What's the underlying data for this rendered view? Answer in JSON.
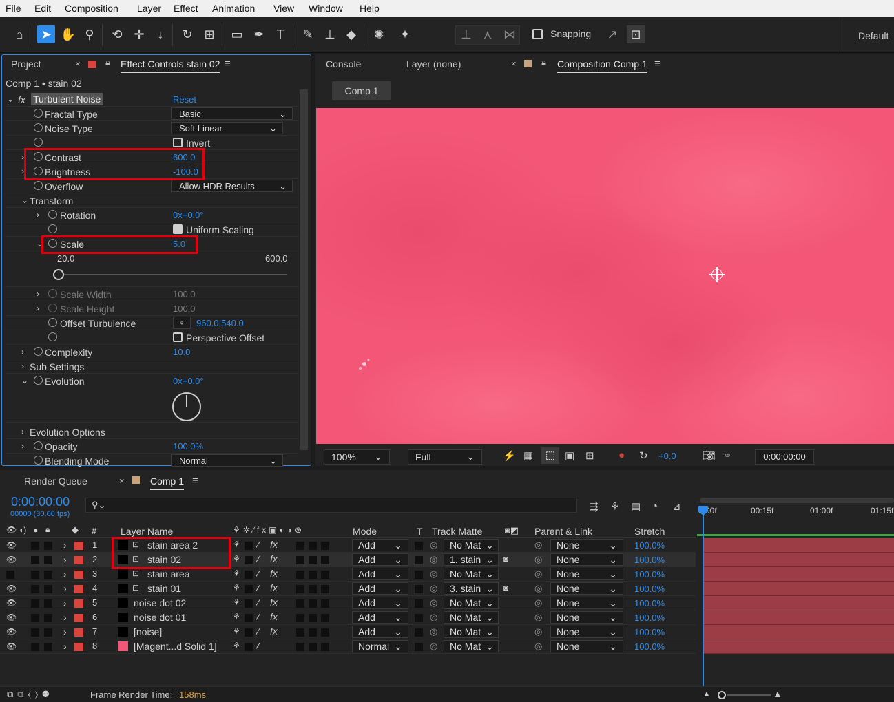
{
  "menu": [
    "File",
    "Edit",
    "Composition",
    "Layer",
    "Effect",
    "Animation",
    "View",
    "Window",
    "Help"
  ],
  "toolbar": {
    "snapping": "Snapping",
    "workspace": "Default"
  },
  "left_panel": {
    "tabs": {
      "project": "Project",
      "effect_controls": "Effect Controls stain 02"
    },
    "breadcrumb": "Comp 1 • stain 02",
    "effect_name": "Turbulent Noise",
    "reset": "Reset",
    "rows": {
      "fractal_type": {
        "label": "Fractal Type",
        "value": "Basic"
      },
      "noise_type": {
        "label": "Noise Type",
        "value": "Soft Linear"
      },
      "invert": {
        "label": "Invert"
      },
      "contrast": {
        "label": "Contrast",
        "value": "600.0"
      },
      "brightness": {
        "label": "Brightness",
        "value": "-100.0"
      },
      "overflow": {
        "label": "Overflow",
        "value": "Allow HDR Results"
      },
      "transform": {
        "label": "Transform"
      },
      "rotation": {
        "label": "Rotation",
        "value": "0x+0.0°"
      },
      "uniform_scaling": {
        "label": "Uniform Scaling"
      },
      "scale": {
        "label": "Scale",
        "value": "5.0",
        "min": "20.0",
        "max": "600.0"
      },
      "scale_width": {
        "label": "Scale Width",
        "value": "100.0"
      },
      "scale_height": {
        "label": "Scale Height",
        "value": "100.0"
      },
      "offset_turbulence": {
        "label": "Offset Turbulence",
        "value": "960.0,540.0"
      },
      "perspective_offset": {
        "label": "Perspective Offset"
      },
      "complexity": {
        "label": "Complexity",
        "value": "10.0"
      },
      "sub_settings": {
        "label": "Sub Settings"
      },
      "evolution": {
        "label": "Evolution",
        "value": "0x+0.0°"
      },
      "evolution_options": {
        "label": "Evolution Options"
      },
      "opacity": {
        "label": "Opacity",
        "value": "100.0%"
      },
      "blending_mode": {
        "label": "Blending Mode",
        "value": "Normal"
      }
    }
  },
  "comp_panel": {
    "tabs": {
      "console": "Console",
      "layer": "Layer (none)",
      "composition": "Composition Comp 1"
    },
    "comp_tab": "Comp 1",
    "zoom": "100%",
    "resolution": "Full",
    "exposure": "+0.0",
    "timecode": "0:00:00:00"
  },
  "timeline": {
    "tabs": {
      "render_queue": "Render Queue",
      "comp": "Comp 1"
    },
    "timecode": "0:00:00:00",
    "frames": "00000 (30.00 fps)",
    "search_placeholder": "",
    "headers": {
      "num": "#",
      "layer_name": "Layer Name",
      "mode": "Mode",
      "t": "T",
      "track_matte": "Track Matte",
      "parent": "Parent & Link",
      "stretch": "Stretch"
    },
    "ruler": [
      "0:00f",
      "00:15f",
      "01:00f",
      "01:15f"
    ],
    "layers": [
      {
        "num": "1",
        "name": "stain area 2",
        "mode": "Add",
        "matte": "No Mat",
        "parent": "None",
        "stretch": "100.0%",
        "color": "#000000"
      },
      {
        "num": "2",
        "name": "stain 02",
        "mode": "Add",
        "matte": "1. stain",
        "parent": "None",
        "stretch": "100.0%",
        "color": "#000000"
      },
      {
        "num": "3",
        "name": "stain area",
        "mode": "Add",
        "matte": "No Mat",
        "parent": "None",
        "stretch": "100.0%",
        "color": "#000000"
      },
      {
        "num": "4",
        "name": "stain 01",
        "mode": "Add",
        "matte": "3. stain",
        "parent": "None",
        "stretch": "100.0%",
        "color": "#000000"
      },
      {
        "num": "5",
        "name": "noise dot 02",
        "mode": "Add",
        "matte": "No Mat",
        "parent": "None",
        "stretch": "100.0%",
        "color": "#000000"
      },
      {
        "num": "6",
        "name": "noise dot 01",
        "mode": "Add",
        "matte": "No Mat",
        "parent": "None",
        "stretch": "100.0%",
        "color": "#000000"
      },
      {
        "num": "7",
        "name": "[noise]",
        "mode": "Add",
        "matte": "No Mat",
        "parent": "None",
        "stretch": "100.0%",
        "color": "#000000"
      },
      {
        "num": "8",
        "name": "[Magent...d Solid 1]",
        "mode": "Normal",
        "matte": "No Mat",
        "parent": "None",
        "stretch": "100.0%",
        "color": "#f35676"
      }
    ],
    "footer": {
      "label": "Frame Render Time:",
      "value": "158ms"
    }
  },
  "colors": {
    "accent": "#2d8ceb",
    "viewer": "#f35676",
    "label_red": "#d9453c",
    "highlight": "#e1000f"
  }
}
